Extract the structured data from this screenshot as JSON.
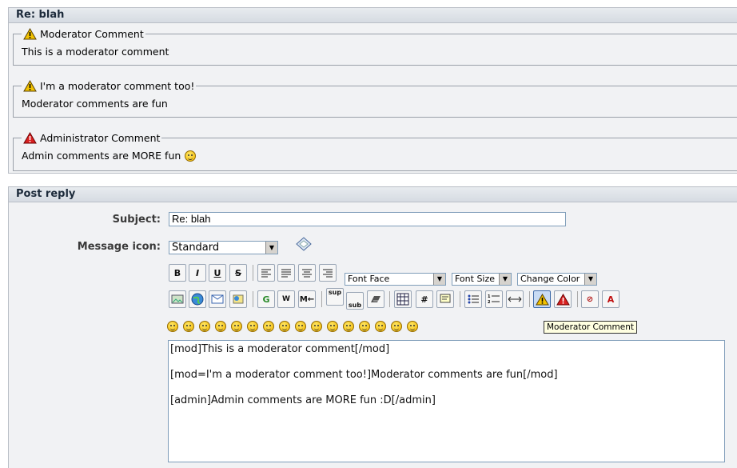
{
  "preview": {
    "title": "Re: blah",
    "quotes": [
      {
        "type": "mod",
        "title": "Moderator Comment",
        "body": "This is a moderator comment"
      },
      {
        "type": "mod",
        "title": "I'm a moderator comment too!",
        "body": "Moderator comments are fun"
      },
      {
        "type": "admin",
        "title": "Administrator Comment",
        "body": "Admin comments are MORE fun"
      }
    ]
  },
  "reply": {
    "title": "Post reply",
    "subject_label": "Subject:",
    "subject_value": "Re: blah",
    "message_icon_label": "Message icon:",
    "message_icon_value": "Standard",
    "font_face": "Font Face",
    "font_size": "Font Size",
    "change_color": "Change Color",
    "format_buttons": [
      "B",
      "I",
      "U",
      "S"
    ],
    "tooltip": "Moderator Comment",
    "message_lines": [
      "[mod]This is a moderator comment[/mod]",
      "[mod=I'm a moderator comment too!]Moderator comments are fun[/mod]",
      "[admin]Admin comments are MORE fun :D[/admin]"
    ]
  },
  "colors": {
    "mod_warning": "#f2c200",
    "admin_warning": "#d92020",
    "header_bg": "#dde2e8"
  }
}
